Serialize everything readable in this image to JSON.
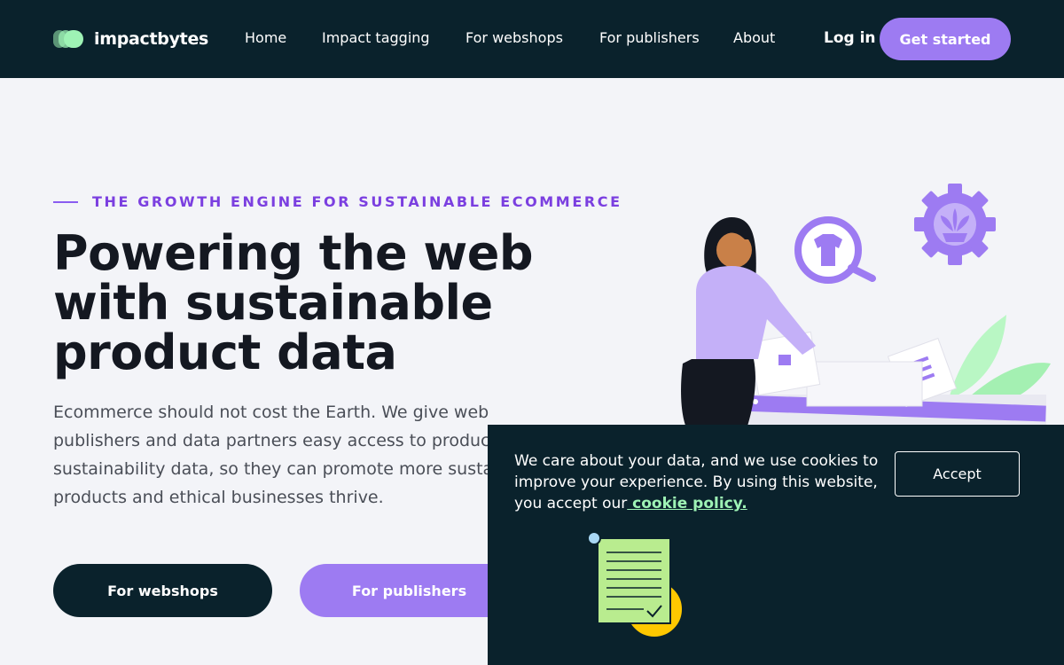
{
  "brand": {
    "name": "impactbytes",
    "accent": "#9d7bf2",
    "dark": "#0a222c",
    "mint": "#9ef3b5"
  },
  "nav": {
    "items": [
      "Home",
      "Impact tagging",
      "For webshops",
      "For publishers",
      "About"
    ],
    "login": "Log in",
    "cta": "Get started"
  },
  "hero": {
    "eyebrow": "THE GROWTH ENGINE FOR SUSTAINABLE ECOMMERCE",
    "headline": "Powering the web with sustainable product data",
    "subtext": "Ecommerce should not cost the Earth. We give web publishers and data partners easy access to product sustainability data, so they can promote more sustainable products and ethical businesses thrive.",
    "buttons": {
      "webshops": "For webshops",
      "publishers": "For publishers"
    }
  },
  "cookie": {
    "text": "We care about your data, and we use cookies to improve your experience. By using this website, you accept our",
    "link": " cookie policy.",
    "accept": "Accept"
  },
  "icons": [
    "logo-mark-icon",
    "tshirt-search-icon",
    "plant-gear-icon"
  ]
}
